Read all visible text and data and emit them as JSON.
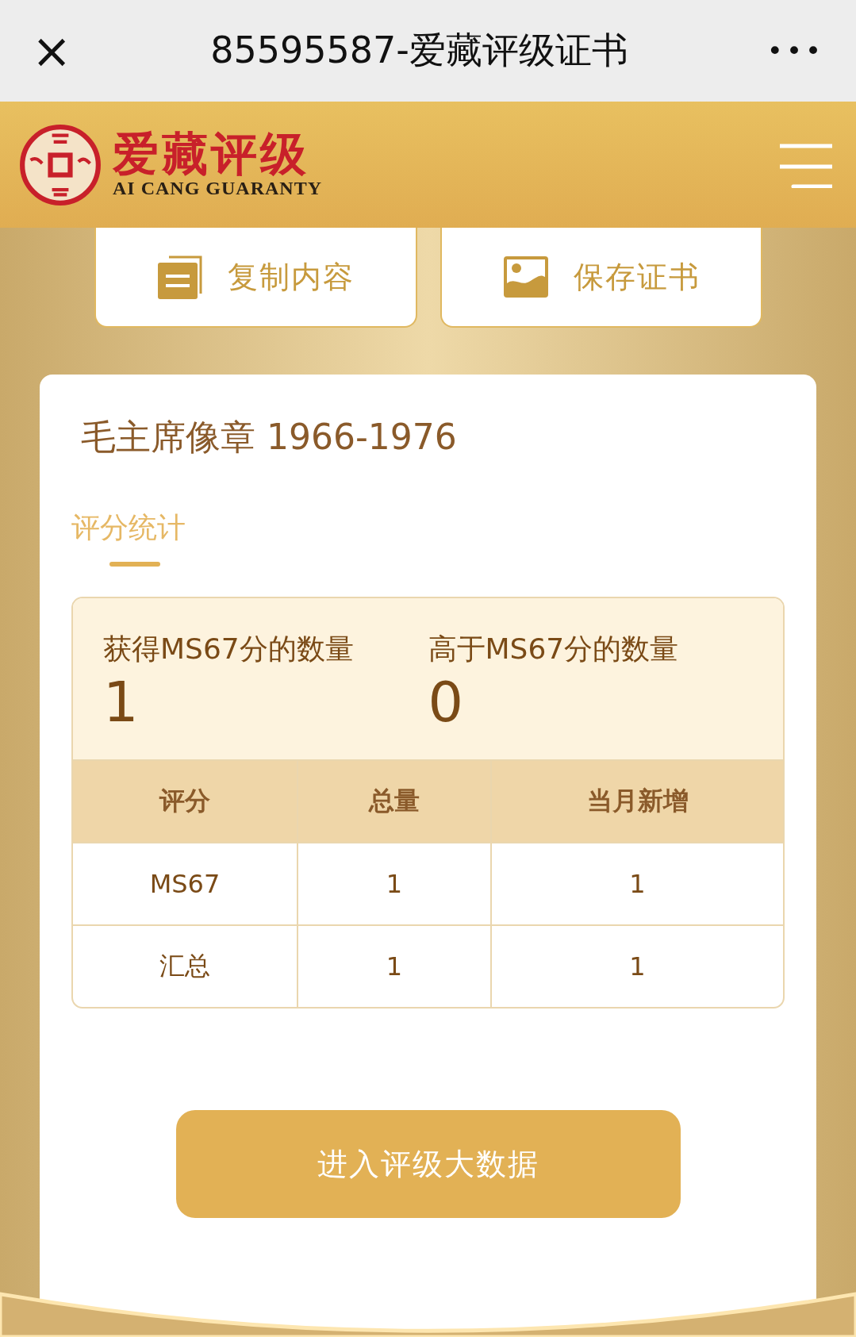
{
  "window": {
    "title": "85595587-爱藏评级证书",
    "close": "×",
    "more": "•••"
  },
  "brand": {
    "name": "爱藏评级",
    "subtitle": "AI CANG GUARANTY"
  },
  "actions": [
    {
      "kind": "copy",
      "label": "复制内容"
    },
    {
      "kind": "image",
      "label": "保存证书"
    }
  ],
  "item": {
    "title": "毛主席像章 1966-1976"
  },
  "tabs": [
    {
      "label": "评分统计",
      "selected": true
    }
  ],
  "stats": [
    {
      "label": "获得MS67分的数量",
      "value": "1"
    },
    {
      "label": "高于MS67分的数量",
      "value": "0"
    }
  ],
  "table": {
    "columns": [
      "评分",
      "总量",
      "当月新增"
    ],
    "rows": [
      [
        "MS67",
        "1",
        "1"
      ],
      [
        "汇总",
        "1",
        "1"
      ]
    ]
  },
  "cta": {
    "label": "进入评级大数据"
  }
}
